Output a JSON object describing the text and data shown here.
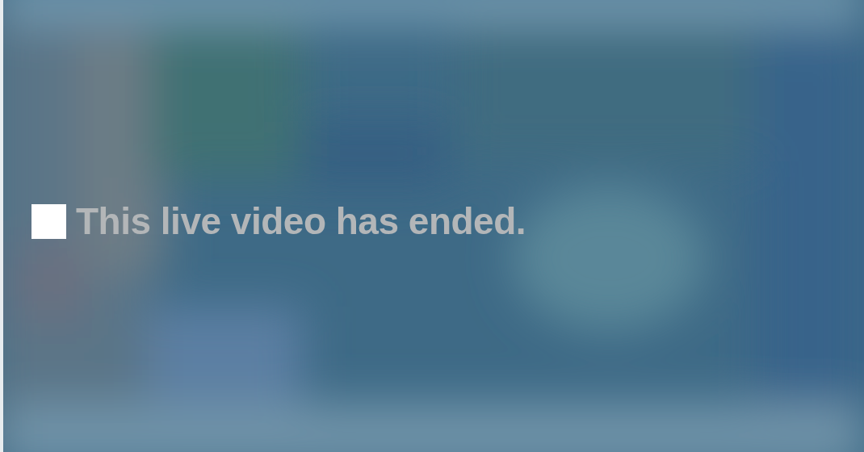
{
  "player": {
    "message": "This live video has ended."
  }
}
